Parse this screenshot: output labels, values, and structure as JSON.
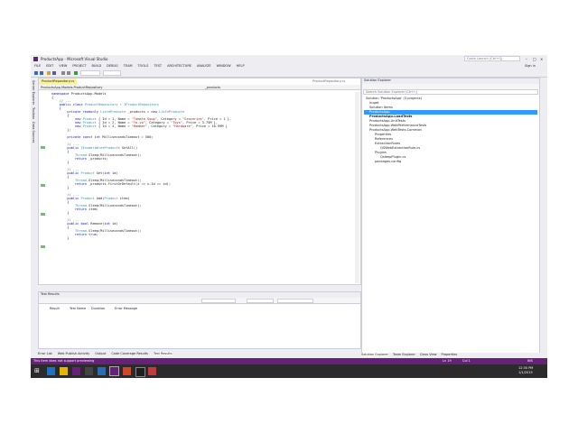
{
  "window": {
    "title": "ProductsApp - Microsoft Visual Studio",
    "quick_launch_placeholder": "Quick Launch (Ctrl+Q)",
    "sign_in": "Sign in"
  },
  "menu": [
    "FILE",
    "EDIT",
    "VIEW",
    "PROJECT",
    "BUILD",
    "DEBUG",
    "TEAM",
    "TOOLS",
    "TEST",
    "ARCHITECTURE",
    "ANALYZE",
    "WINDOW",
    "HELP"
  ],
  "left_tabs": [
    "Server Explorer",
    "Toolbox",
    "Data Sources"
  ],
  "editor": {
    "doc_tab": "ProductRepository.cs",
    "doc_tab2": "ProductRepository.cs",
    "nav_left": "ProductsApp.Models.ProductRepository",
    "nav_right": "_products"
  },
  "test_panel": {
    "title": "Test Results",
    "columns": [
      "Result",
      "Test Name",
      "Duration",
      "Error Message"
    ]
  },
  "bottom_tabs": [
    "Error List",
    "Web Publish Activity",
    "Output",
    "Code Coverage Results",
    "Test Results"
  ],
  "solution_explorer": {
    "title": "Solution Explorer",
    "search_placeholder": "Search Solution Explorer (Ctrl+;)",
    "items": [
      "Solution 'ProductsApp' (3 projects)",
      "nuget",
      "Solution Items",
      "ProductsApp",
      "ProductsApp.LoadTests",
      "ProductsApp.UnitTests",
      "ProductsApp.WebPerformanceTests",
      "ProductsApp.WebTests.Common",
      "Properties",
      "References",
      "ExtractionRules",
      "QSWebExtractionRule.cs",
      "Plugins",
      "QsleepPlugin.cs",
      "packages.config"
    ],
    "tabs": [
      "Solution Explorer",
      "Team Explorer",
      "Class View",
      "Properties"
    ]
  },
  "status": {
    "left": "This item does not support previewing",
    "ln": "Ln 19",
    "col": "Col 1",
    "ins": "INS"
  },
  "clock": {
    "time": "12:30 PM",
    "date": "1/1/2015"
  },
  "colors": {
    "vs_purple": "#68217a",
    "selection": "#3399ff",
    "keyword": "#0000ff",
    "type": "#2b91af",
    "string": "#a31515",
    "comment": "#008000"
  }
}
